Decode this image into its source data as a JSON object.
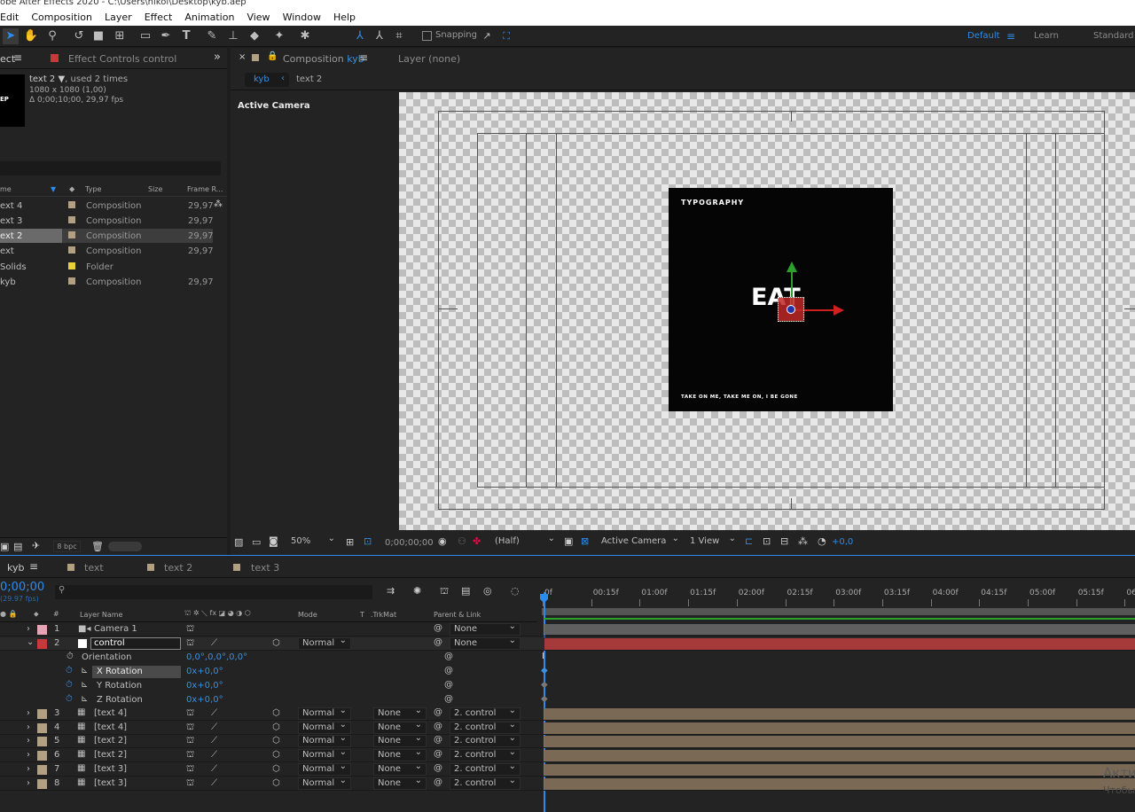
{
  "title": "obe After Effects 2020 - C:\\Users\\nikol\\Desktop\\kyb.aep",
  "menu": [
    "Edit",
    "Composition",
    "Layer",
    "Effect",
    "Animation",
    "View",
    "Window",
    "Help"
  ],
  "toolbar": {
    "snapping": "Snapping",
    "workspaces": [
      "Default",
      "Learn",
      "Standard"
    ]
  },
  "project": {
    "tab_project": "ect",
    "tab_effect": "Effect Controls control",
    "selected": {
      "name": "text 2",
      "usage": ", used 2 times",
      "dims": "1080 x 1080 (1,00)",
      "duration": "Δ 0;00;10;00, 29,97 fps",
      "thumb_text": "EP"
    },
    "columns": [
      "me",
      "Type",
      "Size",
      "Frame R..."
    ],
    "items": [
      {
        "name": "ext 4",
        "type": "Composition",
        "fps": "29,97",
        "color": "#b39f82"
      },
      {
        "name": "ext 3",
        "type": "Composition",
        "fps": "29,97",
        "color": "#b39f82"
      },
      {
        "name": "ext 2",
        "type": "Composition",
        "fps": "29,97",
        "color": "#b39f82"
      },
      {
        "name": "ext",
        "type": "Composition",
        "fps": "29,97",
        "color": "#b39f82"
      },
      {
        "name": "Solids",
        "type": "Folder",
        "fps": "",
        "color": "#e6d23a"
      },
      {
        "name": "kyb",
        "type": "Composition",
        "fps": "29,97",
        "color": "#b39f82"
      }
    ],
    "bpc": "8 bpc"
  },
  "comp": {
    "tab_label": "Composition",
    "tab_name": "kyb",
    "layer_tab": "Layer (none)",
    "crumbs": [
      "kyb",
      "text 2"
    ],
    "camera_label": "Active Camera",
    "art": {
      "top": "TYPOGRAPHY",
      "center": "EAT",
      "bottom": "TAKE ON ME, TAKE ME ON, I BE GONE"
    }
  },
  "viewbar": {
    "zoom": "50%",
    "time": "0;00;00;00",
    "res": "(Half)",
    "camera": "Active Camera",
    "views": "1 View",
    "exposure": "+0,0"
  },
  "timeline": {
    "tabs": [
      "kyb",
      "text 2",
      "text 3"
    ],
    "timecode": "0;00;00",
    "fps": "(29.97 fps)",
    "columns": {
      "layer_name": "Layer Name",
      "mode": "Mode",
      "t": "T",
      "trkmat": ".TrkMat",
      "parent": "Parent & Link"
    },
    "ruler": [
      "0f",
      "00:15f",
      "01:00f",
      "01:15f",
      "02:00f",
      "02:15f",
      "03:00f",
      "03:15f",
      "04:00f",
      "04:15f",
      "05:00f",
      "05:15f",
      "06:00"
    ],
    "layers": [
      {
        "num": "1",
        "name": "Camera 1",
        "color": "#e6a3b5",
        "mode": "",
        "trk": "",
        "parent": "None"
      },
      {
        "num": "2",
        "name": "control",
        "color": "#c63a3a",
        "mode": "Normal",
        "trk": "",
        "parent": "None"
      },
      {
        "num": "3",
        "name": "[text 4]",
        "color": "#b39f82",
        "mode": "Normal",
        "trk": "None",
        "parent": "2. control"
      },
      {
        "num": "4",
        "name": "[text 4]",
        "color": "#b39f82",
        "mode": "Normal",
        "trk": "None",
        "parent": "2. control"
      },
      {
        "num": "5",
        "name": "[text 2]",
        "color": "#b39f82",
        "mode": "Normal",
        "trk": "None",
        "parent": "2. control"
      },
      {
        "num": "6",
        "name": "[text 2]",
        "color": "#b39f82",
        "mode": "Normal",
        "trk": "None",
        "parent": "2. control"
      },
      {
        "num": "7",
        "name": "[text 3]",
        "color": "#b39f82",
        "mode": "Normal",
        "trk": "None",
        "parent": "2. control"
      },
      {
        "num": "8",
        "name": "[text 3]",
        "color": "#b39f82",
        "mode": "Normal",
        "trk": "None",
        "parent": "2. control"
      }
    ],
    "props": [
      {
        "name": "Orientation",
        "value": "0,0°,0,0°,0,0°"
      },
      {
        "name": "X Rotation",
        "value": "0x+0,0°"
      },
      {
        "name": "Y Rotation",
        "value": "0x+0,0°"
      },
      {
        "name": "Z Rotation",
        "value": "0x+0,0°"
      }
    ]
  },
  "watermark": {
    "line1": "Акти",
    "line2": "Чтобы"
  }
}
